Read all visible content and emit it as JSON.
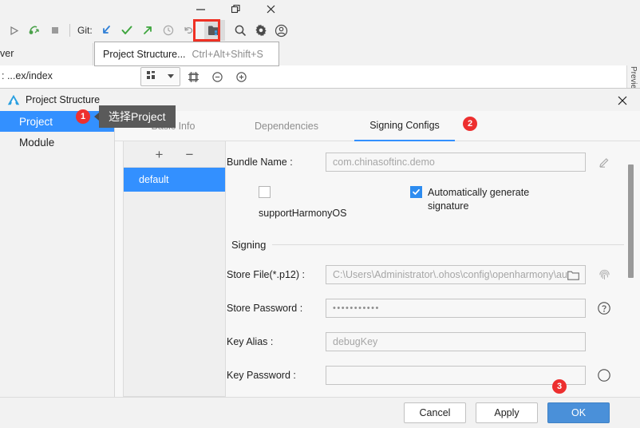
{
  "ide": {
    "window_controls": {
      "minimize": "minimize-icon",
      "maximize": "restore-icon",
      "close": "close-icon"
    },
    "toolbar": {
      "git_label": "Git:",
      "icons": [
        "run-icon",
        "debug-icon",
        "stop-icon",
        "git-update-icon",
        "git-commit-icon",
        "git-push-icon",
        "history-icon",
        "rollback-icon",
        "project-structure-icon",
        "search-icon",
        "settings-icon",
        "account-icon"
      ],
      "highlighted_icon": "project-structure-icon",
      "highlight_color": "#ef3124"
    },
    "tab_row": {
      "truncated_tab": "ver"
    },
    "breadcrumb": {
      "path": ": ...ex/index",
      "tools": [
        "layout-grid-icon",
        "chevron-down-icon",
        "frame-icon",
        "zoom-out-icon",
        "zoom-in-icon"
      ]
    },
    "preview_strip": "Preview",
    "tooltip": {
      "label": "Project Structure...",
      "shortcut": "Ctrl+Alt+Shift+S"
    }
  },
  "dialog": {
    "title": "Project Structure",
    "logo": "deveco-logo-icon",
    "close": "close-icon",
    "nav": {
      "items": [
        {
          "label": "Project",
          "selected": true
        },
        {
          "label": "Module",
          "selected": false
        }
      ]
    },
    "tabs": [
      {
        "label": "Basic Info",
        "active": false
      },
      {
        "label": "Dependencies",
        "active": false
      },
      {
        "label": "Signing Configs",
        "active": true
      }
    ],
    "config_list": {
      "add_label": "+",
      "remove_label": "−",
      "items": [
        {
          "label": "default",
          "selected": true
        }
      ]
    },
    "form": {
      "bundle_name": {
        "label": "Bundle Name :",
        "value": "com.chinasoftinc.demo",
        "edit_icon": "pencil-icon"
      },
      "support_harmony": {
        "label": "supportHarmonyOS",
        "checked": false
      },
      "auto_signature": {
        "label": "Automatically generate signature",
        "checked": true
      },
      "section_title": "Signing",
      "store_file": {
        "label": "Store File(*.p12) :",
        "value": "C:\\Users\\Administrator\\.ohos\\config\\openharmony\\au",
        "browse_icon": "folder-icon",
        "side_icon": "fingerprint-icon"
      },
      "store_password": {
        "label": "Store Password :",
        "value": "•••••••••••",
        "side_icon": "help-circle-icon"
      },
      "key_alias": {
        "label": "Key Alias :",
        "value": "debugKey"
      },
      "key_password": {
        "label": "Key Password :",
        "value": ""
      }
    },
    "footer": {
      "cancel": "Cancel",
      "apply": "Apply",
      "ok": "OK"
    }
  },
  "annotations": {
    "badge1": "1",
    "badge2": "2",
    "badge3": "3",
    "tooltip_cn": "选择Project",
    "badge_color": "#ed2f2f"
  }
}
